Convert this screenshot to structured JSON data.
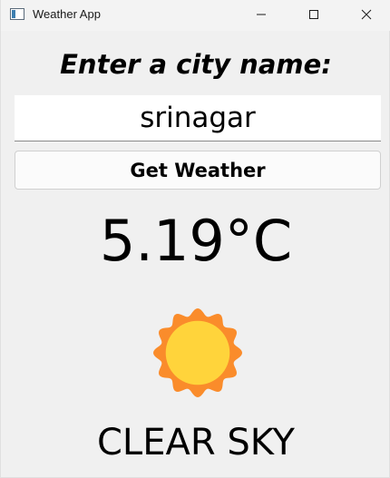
{
  "window": {
    "title": "Weather App",
    "icon": "app-window-icon",
    "controls": [
      "minimize-icon",
      "maximize-icon",
      "close-icon"
    ]
  },
  "form": {
    "prompt": "Enter a city name:",
    "city_value": "srinagar",
    "button_label": "Get Weather"
  },
  "result": {
    "temperature": "5.19°C",
    "condition_icon": "sun-icon",
    "description": "CLEAR SKY"
  },
  "colors": {
    "sun_outer": "#fa8c2b",
    "sun_inner": "#ffd43b",
    "background": "#f0f0f0"
  }
}
